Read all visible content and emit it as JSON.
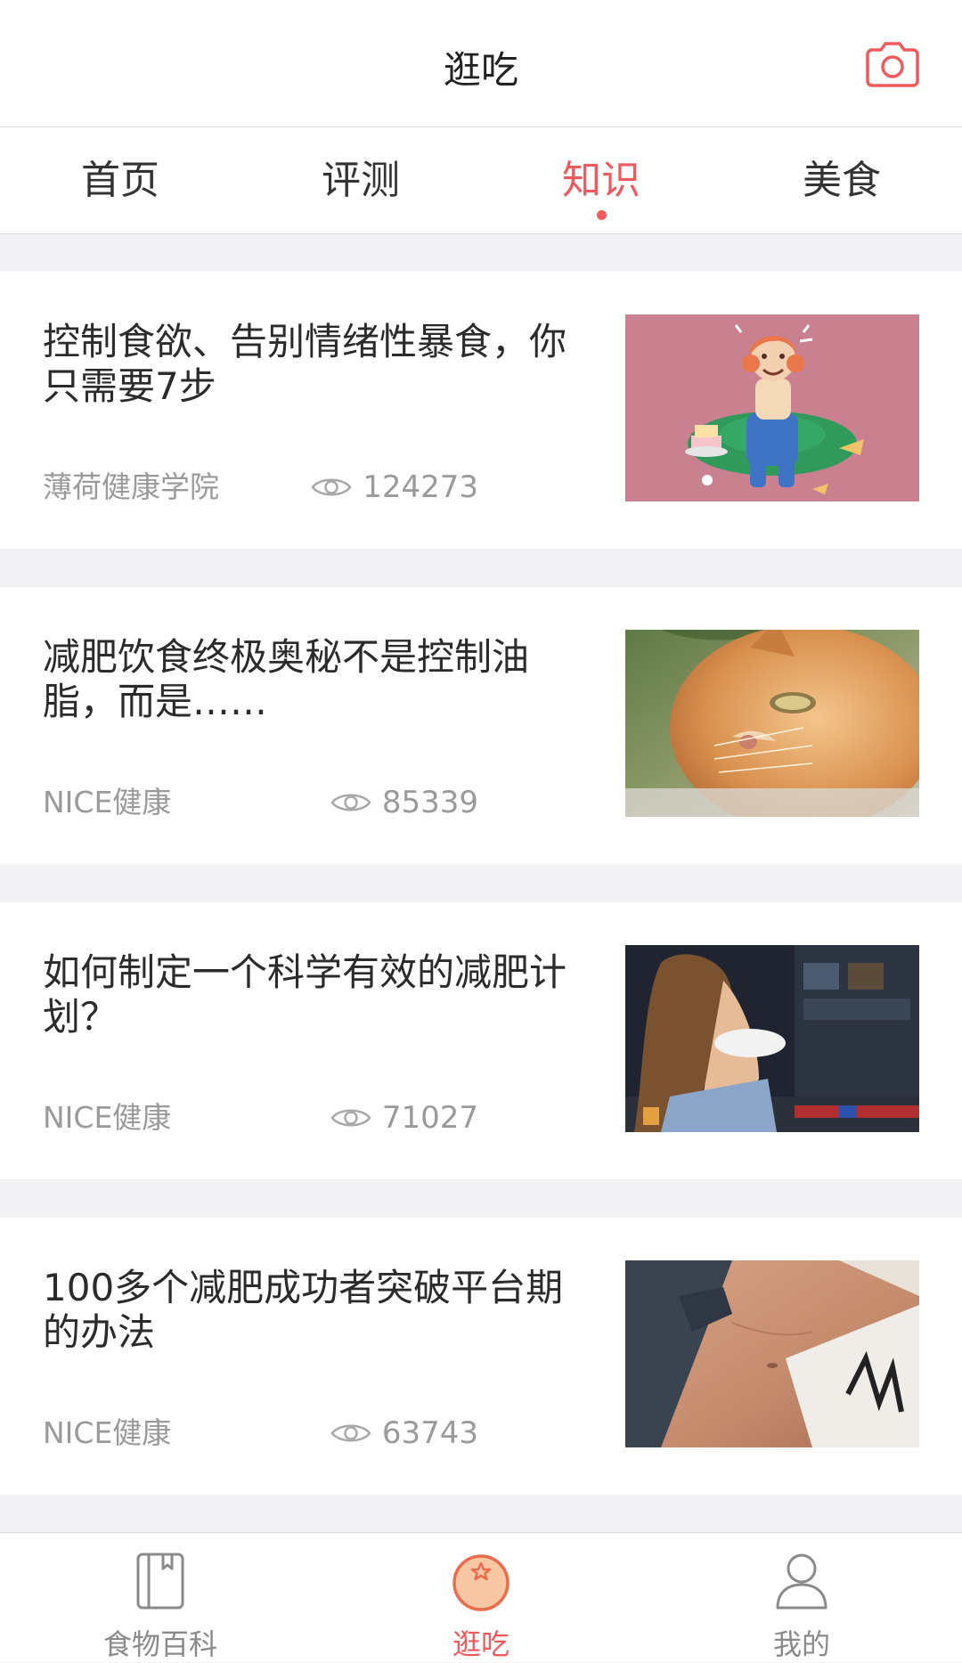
{
  "header": {
    "title": "逛吃",
    "camera_icon": "camera-icon"
  },
  "tabs": [
    {
      "label": "首页",
      "active": false
    },
    {
      "label": "评测",
      "active": false
    },
    {
      "label": "知识",
      "active": true
    },
    {
      "label": "美食",
      "active": false
    }
  ],
  "articles": [
    {
      "title": "控制食欲、告别情绪性暴食，你只需要7步",
      "source": "薄荷健康学院",
      "views": "124273",
      "thumbnail": "illustration-crying-woman-eating"
    },
    {
      "title": "减肥饮食终极奥秘不是控制油脂，而是……",
      "source": "NICE健康",
      "views": "85339",
      "thumbnail": "orange-cat-photo"
    },
    {
      "title": "如何制定一个科学有效的减肥计划？",
      "source": "NICE健康",
      "views": "71027",
      "thumbnail": "woman-fitness-photo"
    },
    {
      "title": "100多个减肥成功者突破平台期的办法",
      "source": "NICE健康",
      "views": "63743",
      "thumbnail": "slim-waist-photo"
    }
  ],
  "bottom_nav": [
    {
      "label": "食物百科",
      "icon": "book-icon",
      "active": false
    },
    {
      "label": "逛吃",
      "icon": "orange-icon",
      "active": true
    },
    {
      "label": "我的",
      "icon": "user-icon",
      "active": false
    }
  ],
  "colors": {
    "accent": "#ef5a5d",
    "background": "#f2f2f4",
    "text_primary": "#2b2b2b",
    "text_secondary": "#9a9a9a"
  }
}
